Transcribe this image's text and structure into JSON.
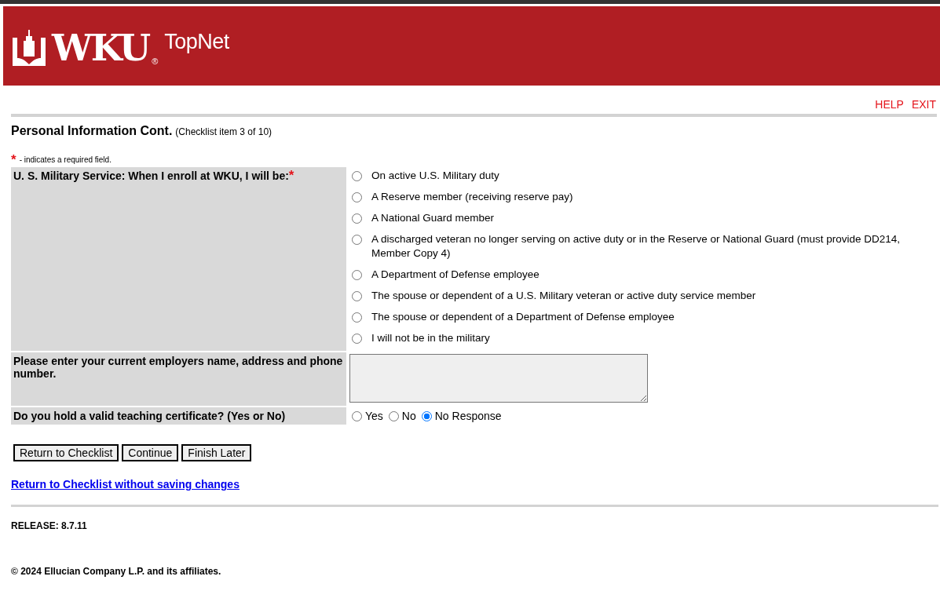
{
  "header": {
    "brand": "WKU",
    "registered": "®",
    "product": "TopNet"
  },
  "top_links": [
    {
      "label": "HELP"
    },
    {
      "label": "EXIT"
    }
  ],
  "page_title": "Personal Information Cont.",
  "page_subtitle": "(Checklist item 3 of 10)",
  "required_note": {
    "mark": "*",
    "text": "- indicates a required field."
  },
  "military": {
    "label": "U. S. Military Service: When I enroll at WKU, I will be:",
    "required_mark": "*",
    "options": [
      {
        "label": "On active U.S. Military duty",
        "selected": false
      },
      {
        "label": "A Reserve member (receiving reserve pay)",
        "selected": false
      },
      {
        "label": "A National Guard member",
        "selected": false
      },
      {
        "label": "A discharged veteran no longer serving on active duty or in the Reserve or National Guard (must provide DD214, Member Copy 4)",
        "selected": false
      },
      {
        "label": "A Department of Defense employee",
        "selected": false
      },
      {
        "label": "The spouse or dependent of a U.S. Military veteran or active duty service member",
        "selected": false
      },
      {
        "label": "The spouse or dependent of a Department of Defense employee",
        "selected": false
      },
      {
        "label": "I will not be in the military",
        "selected": false
      }
    ]
  },
  "employer": {
    "label": "Please enter your current employers name, address and phone number."
  },
  "teaching": {
    "label": "Do you hold a valid teaching certificate? (Yes or No)",
    "options": [
      {
        "label": "Yes",
        "selected": false
      },
      {
        "label": "No",
        "selected": false
      },
      {
        "label": "No Response",
        "selected": true
      }
    ]
  },
  "buttons": [
    "Return to Checklist",
    "Continue",
    "Finish Later"
  ],
  "link": "Return to Checklist without saving changes",
  "release": "RELEASE: 8.7.11",
  "copyright": "© 2024 Ellucian Company L.P. and its affiliates."
}
